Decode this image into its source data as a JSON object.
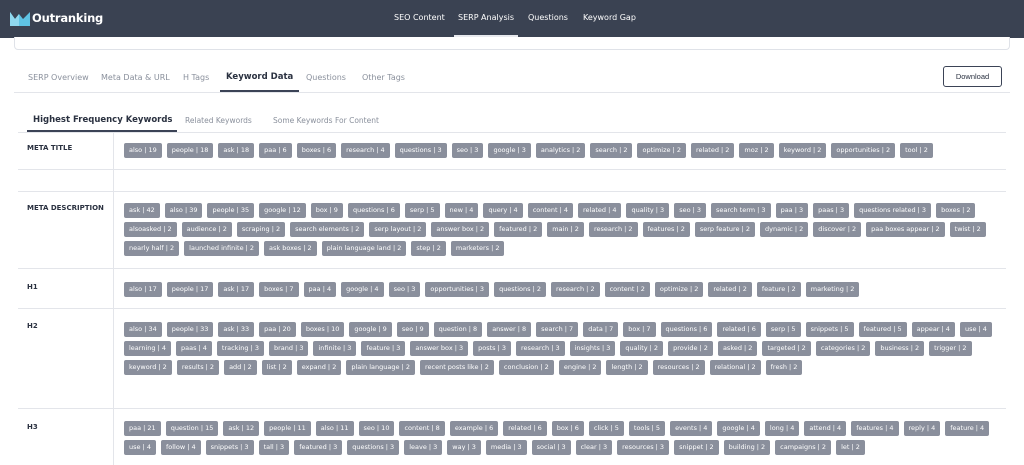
{
  "brand": {
    "name": "Outranking"
  },
  "nav": [
    "SEO Content",
    "SERP Analysis",
    "Questions",
    "Keyword Gap"
  ],
  "tabs": [
    "SERP Overview",
    "Meta Data & URL",
    "H Tags",
    "Keyword Data",
    "Questions",
    "Other Tags"
  ],
  "download_label": "Download",
  "subtabs": [
    "Highest Frequency Keywords",
    "Related Keywords",
    "Some Keywords For Content"
  ],
  "sections": {
    "meta_title": {
      "label": "META TITLE",
      "chips": [
        "also | 19",
        "people | 18",
        "ask | 18",
        "paa | 6",
        "boxes | 6",
        "research | 4",
        "questions | 3",
        "seo | 3",
        "google | 3",
        "analytics | 2",
        "search | 2",
        "optimize | 2",
        "related | 2",
        "moz | 2",
        "keyword | 2",
        "opportunities | 2",
        "tool | 2"
      ]
    },
    "meta_description": {
      "label": "META DESCRIPTION",
      "chips": [
        "ask | 42",
        "also | 39",
        "people | 35",
        "google | 12",
        "box | 9",
        "questions | 6",
        "serp | 5",
        "new | 4",
        "query | 4",
        "content | 4",
        "related | 4",
        "quality | 3",
        "seo | 3",
        "search term | 3",
        "paa | 3",
        "paas | 3",
        "questions related | 3",
        "boxes | 2",
        "alsoasked | 2",
        "audience | 2",
        "scraping | 2",
        "search elements | 2",
        "serp layout | 2",
        "answer box | 2",
        "featured | 2",
        "main | 2",
        "research | 2",
        "features | 2",
        "serp feature | 2",
        "dynamic | 2",
        "discover | 2",
        "paa boxes appear | 2",
        "twist | 2",
        "nearly half | 2",
        "launched infinite | 2",
        "ask boxes | 2",
        "plain language land | 2",
        "step | 2",
        "marketers | 2"
      ]
    },
    "h1": {
      "label": "H1",
      "chips": [
        "also | 17",
        "people | 17",
        "ask | 17",
        "boxes | 7",
        "paa | 4",
        "google | 4",
        "seo | 3",
        "opportunities | 3",
        "questions | 2",
        "research | 2",
        "content | 2",
        "optimize | 2",
        "related | 2",
        "feature | 2",
        "marketing | 2"
      ]
    },
    "h2": {
      "label": "H2",
      "chips": [
        "also | 34",
        "people | 33",
        "ask | 33",
        "paa | 20",
        "boxes | 10",
        "google | 9",
        "seo | 9",
        "question | 8",
        "answer | 8",
        "search | 7",
        "data | 7",
        "box | 7",
        "questions | 6",
        "related | 6",
        "serp | 5",
        "snippets | 5",
        "featured | 5",
        "appear | 4",
        "use | 4",
        "learning | 4",
        "paas | 4",
        "tracking | 3",
        "brand | 3",
        "infinite | 3",
        "feature | 3",
        "answer box | 3",
        "posts | 3",
        "research | 3",
        "insights | 3",
        "quality | 2",
        "provide | 2",
        "asked | 2",
        "targeted | 2",
        "categories | 2",
        "business | 2",
        "trigger | 2",
        "keyword | 2",
        "results | 2",
        "add | 2",
        "list | 2",
        "expand | 2",
        "plain language | 2",
        "recent posts like | 2",
        "conclusion | 2",
        "engine | 2",
        "length | 2",
        "resources | 2",
        "relational | 2",
        "fresh | 2"
      ]
    },
    "h3": {
      "label": "H3",
      "chips": [
        "paa | 21",
        "question | 15",
        "ask | 12",
        "people | 11",
        "also | 11",
        "seo | 10",
        "content | 8",
        "example | 6",
        "related | 6",
        "box | 6",
        "click | 5",
        "tools | 5",
        "events | 4",
        "google | 4",
        "long | 4",
        "attend | 4",
        "features | 4",
        "reply | 4",
        "feature | 4",
        "use | 4",
        "follow | 4",
        "snippets | 3",
        "tall | 3",
        "featured | 3",
        "questions | 3",
        "leave | 3",
        "way | 3",
        "media | 3",
        "social | 3",
        "clear | 3",
        "resources | 3",
        "snippet | 2",
        "building | 2",
        "campaigns | 2",
        "let | 2"
      ]
    }
  }
}
